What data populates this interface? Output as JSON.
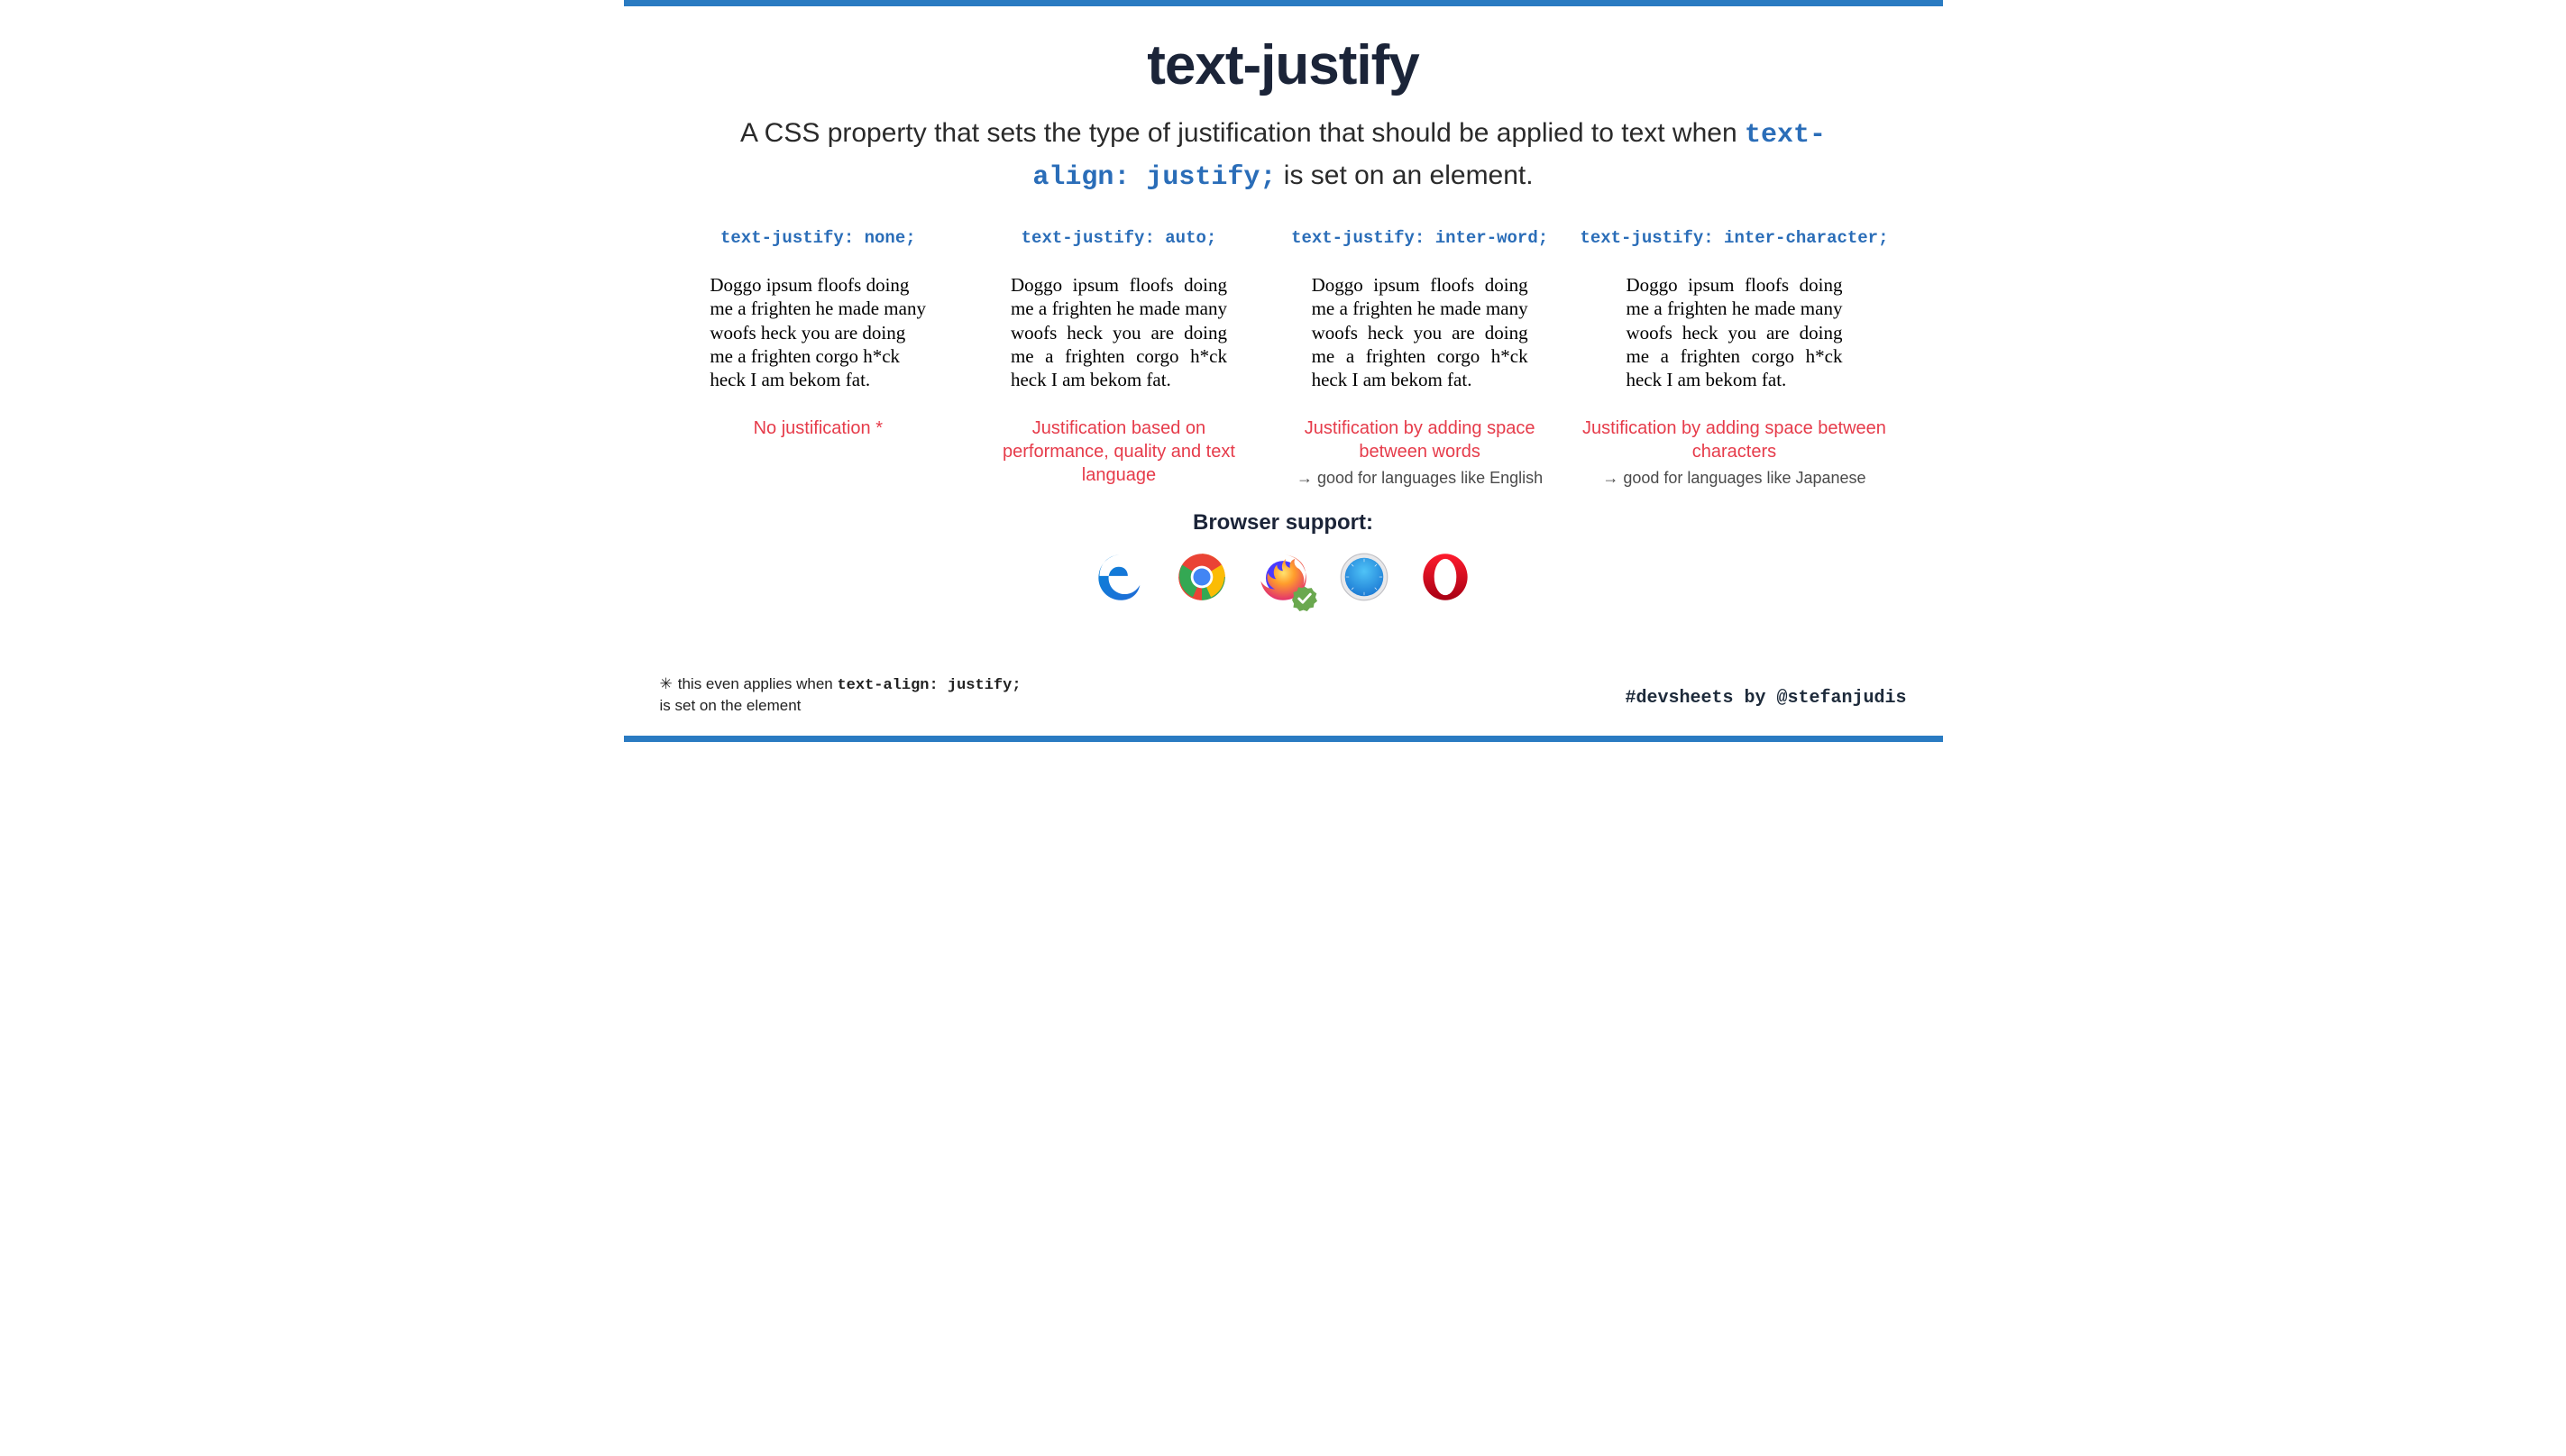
{
  "title": "text-justify",
  "subtitle": {
    "pre": "A CSS property that sets the type of justification that should be applied to text when ",
    "code": "text-align: justify;",
    "post": " is set on an element."
  },
  "sample_text": "Doggo ipsum floofs doing me a frighten he made many woofs heck you are doing me a frighten corgo h*ck heck I am bekom fat.",
  "columns": [
    {
      "heading": "text-justify: none;",
      "caption": "No justification *",
      "note": ""
    },
    {
      "heading": "text-justify: auto;",
      "caption": "Justification based on performance, quality and text language",
      "note": ""
    },
    {
      "heading": "text-justify: inter-word;",
      "caption": "Justification by adding space between words",
      "note": "good for languages like English"
    },
    {
      "heading": "text-justify: inter-character;",
      "caption": "Justification by adding space between characters",
      "note": "good for languages like Japanese"
    }
  ],
  "support_title": "Browser support:",
  "browsers": [
    "edge",
    "chrome",
    "firefox",
    "safari",
    "opera"
  ],
  "firefox_supported": true,
  "footnote": {
    "marker": "✳",
    "pre": "this even applies when ",
    "code": "text-align: justify;",
    "post": " is set on the element"
  },
  "credit": "#devsheets by @stefanjudis"
}
